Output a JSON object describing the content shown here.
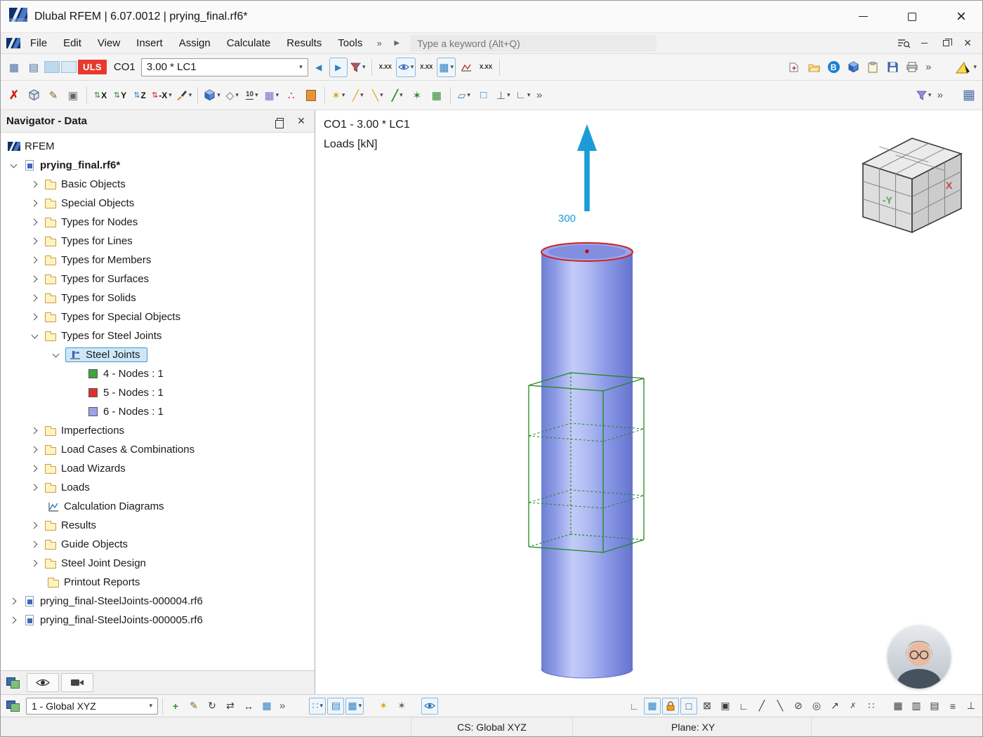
{
  "window": {
    "title": "Dlubal RFEM | 6.07.0012 | prying_final.rf6*"
  },
  "menu": {
    "items": [
      "File",
      "Edit",
      "View",
      "Insert",
      "Assign",
      "Calculate",
      "Results",
      "Tools"
    ],
    "search_placeholder": "Type a keyword (Alt+Q)"
  },
  "toolbar": {
    "uls_label": "ULS",
    "co_label": "CO1",
    "load_combo_value": "3.00 * LC1",
    "value_icon_label": "X.XX",
    "dim_label": "10",
    "axis_labels": [
      "X",
      "Y",
      "Z",
      "-X"
    ],
    "b_letter": "B"
  },
  "navigator": {
    "title": "Navigator - Data",
    "items": [
      "RFEM",
      "prying_final.rf6*",
      "Basic Objects",
      "Special Objects",
      "Types for Nodes",
      "Types for Lines",
      "Types for Members",
      "Types for Surfaces",
      "Types for Solids",
      "Types for Special Objects",
      "Types for Steel Joints",
      "Steel Joints",
      "4 - Nodes : 1",
      "5 - Nodes : 1",
      "6 - Nodes : 1",
      "Imperfections",
      "Load Cases & Combinations",
      "Load Wizards",
      "Loads",
      "Calculation Diagrams",
      "Results",
      "Guide Objects",
      "Steel Joint Design",
      "Printout Reports",
      "prying_final-SteelJoints-000004.rf6",
      "prying_final-SteelJoints-000005.rf6"
    ]
  },
  "viewport": {
    "load_case_label": "CO1 - 3.00 * LC1",
    "loads_unit_label": "Loads [kN]",
    "load_value": "300",
    "nav_cube_front": "-Y",
    "nav_cube_right": "X"
  },
  "bottom_bar": {
    "cs_combo_value": "1 - Global XYZ"
  },
  "status_bar": {
    "cs_label": "CS: Global XYZ",
    "plane_label": "Plane: XY"
  },
  "icons": {
    "overflow": "»",
    "run_arrow": "▶",
    "prev_arrow": "◀",
    "next_arrow": "▶",
    "dropdown_arrow": "▾",
    "close": "×",
    "table_grid": "▦",
    "table_rows": "▤",
    "table_cols": "▥",
    "edit_pencil": "✎",
    "delete_x": "✗",
    "copy_box": "▣",
    "axis_arrows": "⇅",
    "star": "✶",
    "mesh_dots": "∴",
    "diamond": "◇",
    "slash": "╱",
    "backslash": "╲",
    "surface": "▱",
    "square": "□",
    "crossed_square": "⊠",
    "rotate": "↻",
    "swap": "⇄",
    "h_arrow": "↔",
    "plus": "+",
    "angle": "∟",
    "no_snap": "⊘",
    "center_snap": "◎",
    "ne_arrow": "↗",
    "grid_dots": "∷",
    "lines": "≡",
    "perp": "⊥"
  },
  "colors": {
    "accent_blue": "#2f7fc1",
    "selection_blue": "#cfe6f8",
    "uls_red": "#e8392d",
    "load_arrow_blue": "#1b9cd8",
    "cylinder_blue": "#8d9ce8",
    "wireframe_green": "#1e8a1e",
    "selected_rim_red": "#d02020",
    "cube_y_green": "#55aa55",
    "cube_x_red": "#cc4444"
  }
}
